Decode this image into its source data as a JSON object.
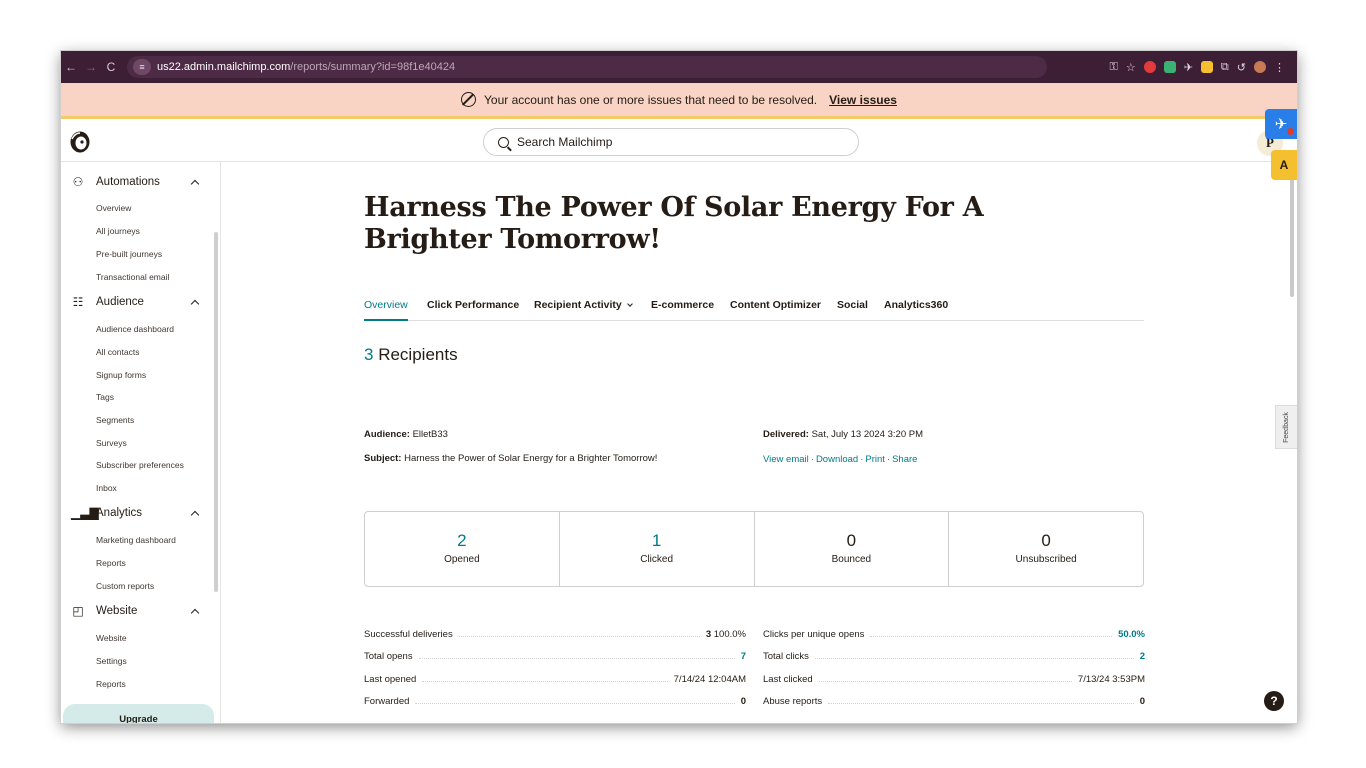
{
  "browser": {
    "url_host": "us22.admin.mailchimp.com",
    "url_path": "/reports/summary?id=98f1e40424",
    "site_control_icon": "tune-icon",
    "back_icon": "←",
    "forward_icon": "→",
    "reload_icon": "C"
  },
  "alert": {
    "message": "Your account has one or more issues that need to be resolved.",
    "link": "View issues"
  },
  "topbar": {
    "search_placeholder": "Search Mailchimp",
    "avatar_initial": "P"
  },
  "sidebar": {
    "sections": [
      {
        "label": "Automations",
        "icon": "automations-icon",
        "items": [
          "Overview",
          "All journeys",
          "Pre-built journeys",
          "Transactional email"
        ]
      },
      {
        "label": "Audience",
        "icon": "audience-icon",
        "items": [
          "Audience dashboard",
          "All contacts",
          "Signup forms",
          "Tags",
          "Segments",
          "Surveys",
          "Subscriber preferences",
          "Inbox"
        ]
      },
      {
        "label": "Analytics",
        "icon": "analytics-icon",
        "items": [
          "Marketing dashboard",
          "Reports",
          "Custom reports"
        ]
      },
      {
        "label": "Website",
        "icon": "website-icon",
        "items": [
          "Website",
          "Settings",
          "Reports"
        ]
      }
    ],
    "upgrade": "Upgrade"
  },
  "report": {
    "title": "Harness The Power Of Solar Energy For A Brighter Tomorrow!",
    "tabs": [
      "Overview",
      "Click Performance",
      "Recipient Activity",
      "E-commerce",
      "Content Optimizer",
      "Social",
      "Analytics360"
    ],
    "recipients_count": "3",
    "recipients_label": "Recipients",
    "audience_label": "Audience:",
    "audience_value": "ElletB33",
    "subject_label": "Subject:",
    "subject_value": "Harness the Power of Solar Energy for a Brighter Tomorrow!",
    "delivered_label": "Delivered:",
    "delivered_value": "Sat, July 13 2024 3:20 PM",
    "links": [
      "View email",
      "Download",
      "Print",
      "Share"
    ],
    "link_separator": "·",
    "stats": [
      {
        "value": "2",
        "label": "Opened",
        "accent": true
      },
      {
        "value": "1",
        "label": "Clicked",
        "accent": true
      },
      {
        "value": "0",
        "label": "Bounced",
        "accent": false
      },
      {
        "value": "0",
        "label": "Unsubscribed",
        "accent": false
      }
    ],
    "left_metrics": [
      {
        "label": "Successful deliveries",
        "value_bold": "3",
        "value_rest": " 100.0%"
      },
      {
        "label": "Total opens",
        "value": "7",
        "style": "teal"
      },
      {
        "label": "Last opened",
        "value": "7/14/24 12:04AM",
        "style": "plain"
      },
      {
        "label": "Forwarded",
        "value": "0",
        "style": "bold"
      }
    ],
    "right_metrics": [
      {
        "label": "Clicks per unique opens",
        "value": "50.0%",
        "style": "teal"
      },
      {
        "label": "Total clicks",
        "value": "2",
        "style": "teal"
      },
      {
        "label": "Last clicked",
        "value": "7/13/24 3:53PM",
        "style": "plain"
      },
      {
        "label": "Abuse reports",
        "value": "0",
        "style": "bold"
      }
    ]
  },
  "widgets": {
    "feedback": "Feedback",
    "help": "?",
    "warn": "A"
  },
  "colors": {
    "accent": "#007c89",
    "banner_bg": "#f9d3c4",
    "banner_border": "#f3c969",
    "chrome_bg": "#3c1f35",
    "upgrade_bg": "#d5ebe9"
  }
}
